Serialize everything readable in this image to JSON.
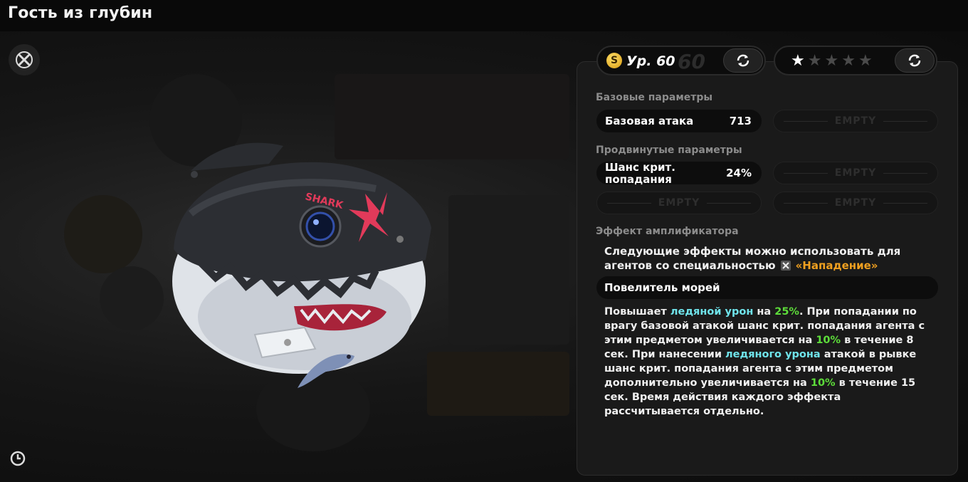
{
  "window": {
    "title": "Гость из глубин"
  },
  "level": {
    "label": "Ур. 60",
    "coin_letter": "S",
    "max_label": "60",
    "refresh_icon": "refresh-icon"
  },
  "rarity": {
    "stars_filled": 1,
    "stars_total": 5
  },
  "base_params": {
    "heading": "Базовые параметры",
    "stats": [
      {
        "name": "Базовая атака",
        "value": "713"
      }
    ],
    "empty_label": "EMPTY"
  },
  "advanced_params": {
    "heading": "Продвинутые параметры",
    "stats": [
      {
        "name_line1": "Шанс крит.",
        "name_line2": "попадания",
        "value": "24%"
      }
    ],
    "empty_label": "EMPTY"
  },
  "amplifier": {
    "heading": "Эффект амплификатора",
    "intro_text": "Следующие эффекты можно использовать для агентов со специальностью",
    "specialty": "«Нападение»",
    "effect_name": "Повелитель морей"
  },
  "description": {
    "segments": [
      {
        "text": "Повышает ",
        "hl": ""
      },
      {
        "text": "ледяной урон",
        "hl": "ice"
      },
      {
        "text": " на ",
        "hl": ""
      },
      {
        "text": "25%",
        "hl": "num"
      },
      {
        "text": ". При попадании по врагу базовой атакой шанс крит. попадания агента с этим предметом увеличивается на ",
        "hl": ""
      },
      {
        "text": "10%",
        "hl": "num"
      },
      {
        "text": " в течение 8 сек. При нанесении ",
        "hl": ""
      },
      {
        "text": "ледяного урона",
        "hl": "ice"
      },
      {
        "text": " атакой в рывке шанс крит. попадания агента с этим предметом дополнительно увеличивается на ",
        "hl": ""
      },
      {
        "text": "10%",
        "hl": "num"
      },
      {
        "text": " в течение 15 сек. Время действия каждого эффекта рассчитывается отдельно.",
        "hl": ""
      }
    ]
  },
  "colors": {
    "accent_gold": "#f0a020",
    "ice_highlight": "#6fe3ea",
    "number_highlight": "#5ddc3a"
  }
}
